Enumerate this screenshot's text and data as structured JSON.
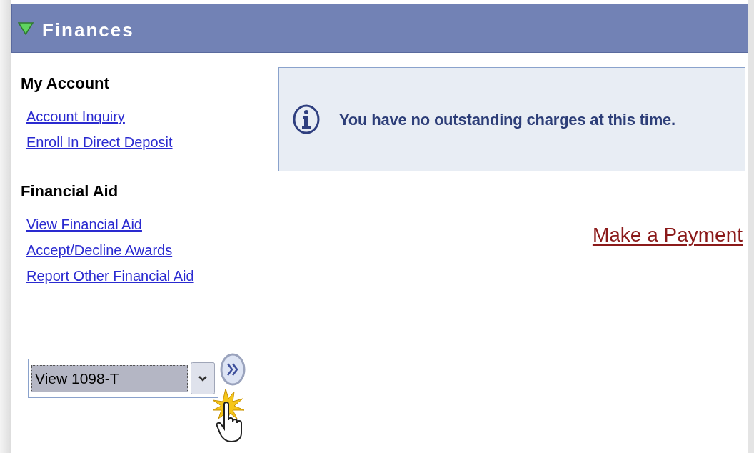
{
  "panel": {
    "title": "Finances",
    "expanded": true
  },
  "sections": [
    {
      "heading": "My Account",
      "links": [
        "Account Inquiry",
        "Enroll In Direct Deposit"
      ]
    },
    {
      "heading": "Financial Aid",
      "links": [
        "View Financial Aid",
        "Accept/Decline Awards",
        "Report Other Financial Aid"
      ]
    }
  ],
  "message": {
    "text": "You have no outstanding charges at this time."
  },
  "payment_link": "Make a Payment",
  "dropdown": {
    "value": "View 1098-T"
  }
}
